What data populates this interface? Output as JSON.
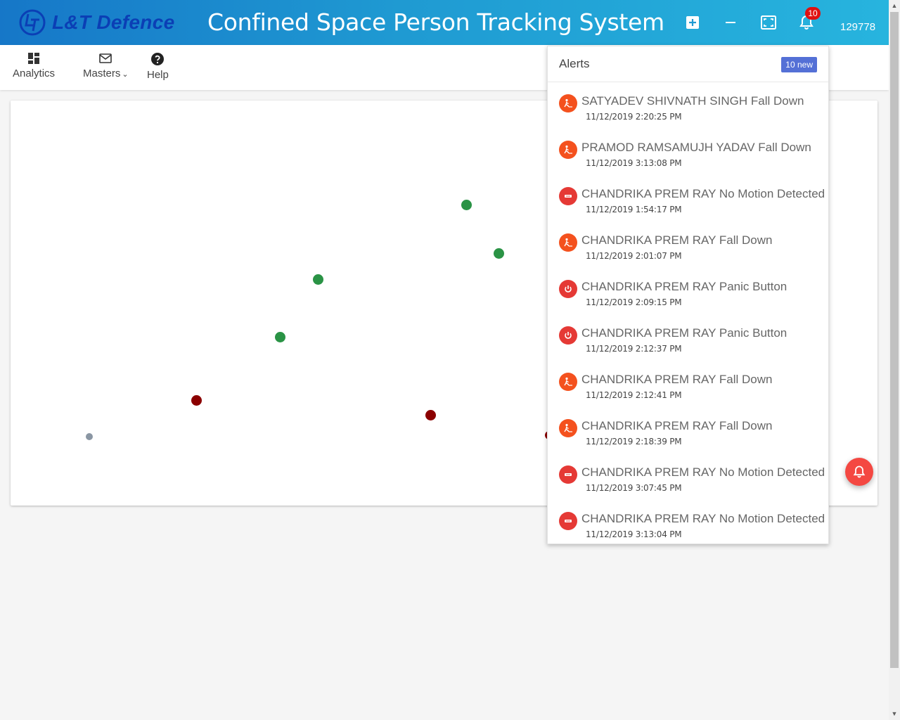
{
  "header": {
    "brand_name": "L&T Defence",
    "app_title": "Confined Space Person Tracking System",
    "icons": [
      "add-box-icon",
      "minus-icon",
      "fullscreen-icon",
      "bell-icon"
    ],
    "notification_count": "10",
    "user_id": "129778"
  },
  "menu": {
    "items": [
      {
        "label": "Analytics",
        "icon": "dashboard-icon"
      },
      {
        "label": "Masters",
        "icon": "mail-icon",
        "has_dropdown": true
      },
      {
        "label": "Help",
        "icon": "help-circle-icon"
      }
    ],
    "dropdown_caret": "⌄"
  },
  "map": {
    "status_colors": {
      "safe": "#2a9345",
      "alert": "#8b0000",
      "inactive": "#8a96a3"
    }
  },
  "alerts": {
    "title": "Alerts",
    "new_label": "10 new",
    "items": [
      {
        "text": "SATYADEV SHIVNATH SINGH Fall Down",
        "time": "11/12/2019 2:20:25 PM",
        "type": "fall-down",
        "icon": "fall-person-icon",
        "color": "#f4511e"
      },
      {
        "text": "PRAMOD RAMSAMUJH YADAV Fall Down",
        "time": "11/12/2019 3:13:08 PM",
        "type": "fall-down",
        "icon": "fall-person-icon",
        "color": "#f4511e"
      },
      {
        "text": "CHANDRIKA PREM RAY No Motion Detected",
        "time": "11/12/2019 1:54:17 PM",
        "type": "no-motion",
        "icon": "no-motion-icon",
        "color": "#e53935"
      },
      {
        "text": "CHANDRIKA PREM RAY Fall Down",
        "time": "11/12/2019 2:01:07 PM",
        "type": "fall-down",
        "icon": "fall-person-icon",
        "color": "#f4511e"
      },
      {
        "text": "CHANDRIKA PREM RAY Panic Button",
        "time": "11/12/2019 2:09:15 PM",
        "type": "panic",
        "icon": "power-icon",
        "color": "#e53935"
      },
      {
        "text": "CHANDRIKA PREM RAY Panic Button",
        "time": "11/12/2019 2:12:37 PM",
        "type": "panic",
        "icon": "power-icon",
        "color": "#e53935"
      },
      {
        "text": "CHANDRIKA PREM RAY Fall Down",
        "time": "11/12/2019 2:12:41 PM",
        "type": "fall-down",
        "icon": "fall-person-icon",
        "color": "#f4511e"
      },
      {
        "text": "CHANDRIKA PREM RAY Fall Down",
        "time": "11/12/2019 2:18:39 PM",
        "type": "fall-down",
        "icon": "fall-person-icon",
        "color": "#f4511e"
      },
      {
        "text": "CHANDRIKA PREM RAY No Motion Detected",
        "time": "11/12/2019 3:07:45 PM",
        "type": "no-motion",
        "icon": "no-motion-icon",
        "color": "#e53935"
      },
      {
        "text": "CHANDRIKA PREM RAY No Motion Detected",
        "time": "11/12/2019 3:13:04 PM",
        "type": "no-motion",
        "icon": "no-motion-icon",
        "color": "#e53935"
      }
    ]
  },
  "fab": {
    "icon": "bell-icon",
    "color": "#f44842"
  }
}
